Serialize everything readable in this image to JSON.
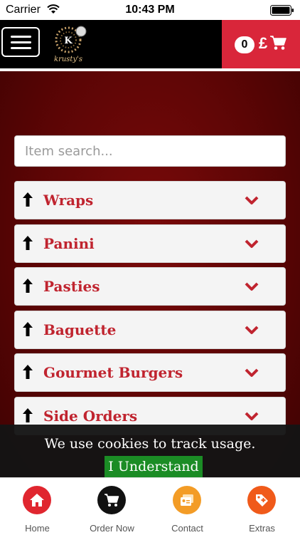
{
  "status_bar": {
    "carrier": "Carrier",
    "time": "10:43 PM"
  },
  "header": {
    "logo_text": "krusty's",
    "cart": {
      "count": "0",
      "currency": "£"
    }
  },
  "search": {
    "placeholder": "Item search..."
  },
  "categories": [
    {
      "label": "Wraps"
    },
    {
      "label": "Panini"
    },
    {
      "label": "Pasties"
    },
    {
      "label": "Baguette"
    },
    {
      "label": "Gourmet Burgers"
    },
    {
      "label": "Side Orders"
    }
  ],
  "cookie_banner": {
    "message": "We use cookies to track usage.",
    "button": "I Understand"
  },
  "tabbar": [
    {
      "label": "Home",
      "icon": "home-icon",
      "color": "#e0262f"
    },
    {
      "label": "Order Now",
      "icon": "cart-icon",
      "color": "#111111"
    },
    {
      "label": "Contact",
      "icon": "contact-card-icon",
      "color": "#f39c26"
    },
    {
      "label": "Extras",
      "icon": "tag-plus-icon",
      "color": "#f05a1a"
    }
  ],
  "colors": {
    "accent_red": "#d9263a",
    "category_text": "#c0242f",
    "cookie_button": "#1b8c25",
    "background": "#5c0505"
  }
}
